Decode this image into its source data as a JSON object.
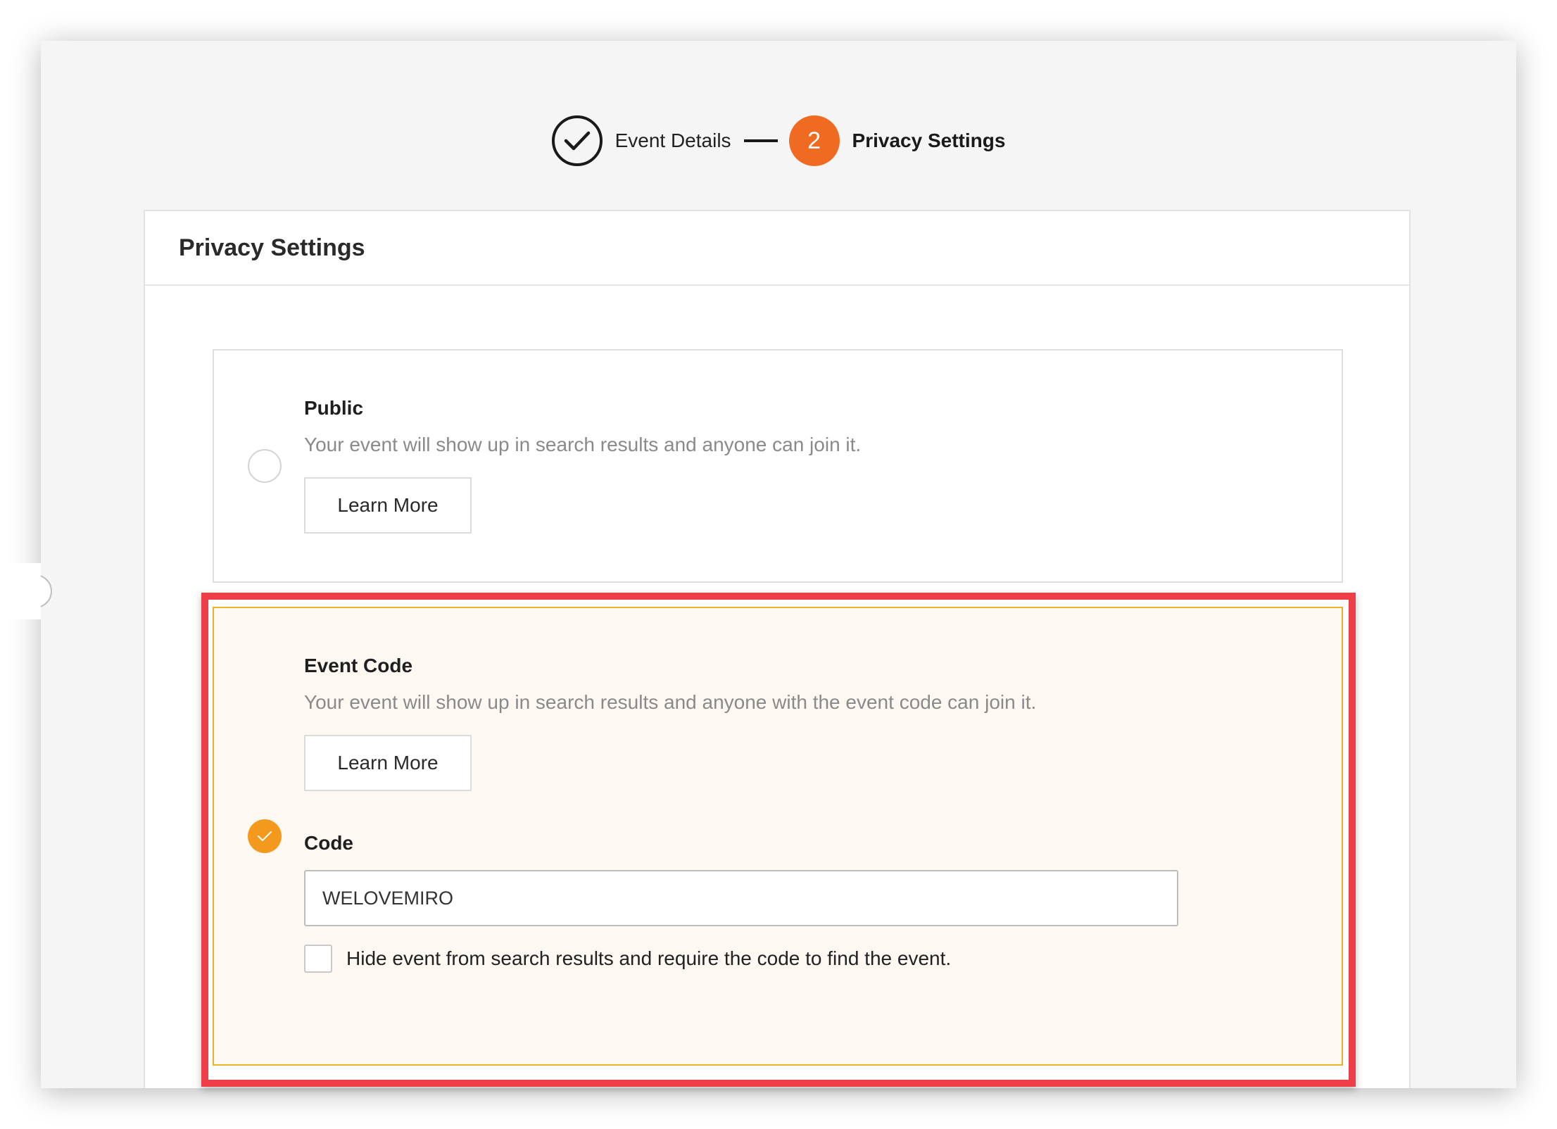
{
  "stepper": {
    "step1_label": "Event Details",
    "step2_number": "2",
    "step2_label": "Privacy Settings"
  },
  "panel": {
    "title": "Privacy Settings"
  },
  "options": {
    "public": {
      "title": "Public",
      "description": "Your event will show up in search results and anyone can join it.",
      "learn_more": "Learn More",
      "selected": false
    },
    "event_code": {
      "title": "Event Code",
      "description": "Your event will show up in search results and anyone with the event code can join it.",
      "learn_more": "Learn More",
      "selected": true,
      "code_label": "Code",
      "code_value": "WELOVEMIRO",
      "hide_checkbox_label": "Hide event from search results and require the code to find the event.",
      "hide_checked": false
    }
  },
  "colors": {
    "accent_orange": "#f06b22",
    "radio_selected": "#f39a1e",
    "selected_border": "#efb12a",
    "highlight_red": "#ee3e47"
  },
  "icons": {
    "step1": "checkmark-circle-icon",
    "selected_radio": "checkmark-icon"
  }
}
